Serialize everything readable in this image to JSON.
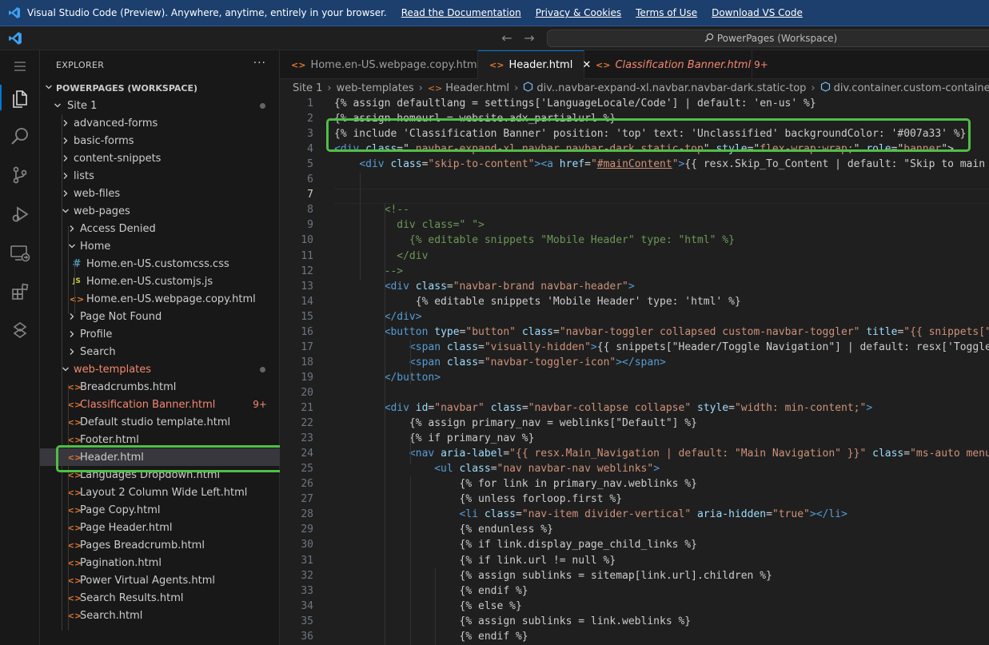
{
  "banner": {
    "text": "Visual Studio Code (Preview). Anywhere, anytime, entirely in your browser.",
    "links": [
      "Read the Documentation",
      "Privacy & Cookies",
      "Terms of Use",
      "Download VS Code"
    ]
  },
  "titlebar": {
    "command_center": "PowerPages (Workspace)"
  },
  "sidebar": {
    "title": "EXPLORER",
    "workspace": "POWERPAGES (WORKSPACE)",
    "tree": [
      {
        "label": "Site 1",
        "depth": 0,
        "kind": "folder-open",
        "modified": true
      },
      {
        "label": "advanced-forms",
        "depth": 1,
        "kind": "folder"
      },
      {
        "label": "basic-forms",
        "depth": 1,
        "kind": "folder"
      },
      {
        "label": "content-snippets",
        "depth": 1,
        "kind": "folder"
      },
      {
        "label": "lists",
        "depth": 1,
        "kind": "folder"
      },
      {
        "label": "web-files",
        "depth": 1,
        "kind": "folder"
      },
      {
        "label": "web-pages",
        "depth": 1,
        "kind": "folder-open"
      },
      {
        "label": "Access Denied",
        "depth": 2,
        "kind": "folder"
      },
      {
        "label": "Home",
        "depth": 2,
        "kind": "folder-open"
      },
      {
        "label": "Home.en-US.customcss.css",
        "depth": 3,
        "kind": "css"
      },
      {
        "label": "Home.en-US.customjs.js",
        "depth": 3,
        "kind": "js"
      },
      {
        "label": "Home.en-US.webpage.copy.html",
        "depth": 3,
        "kind": "html"
      },
      {
        "label": "Page Not Found",
        "depth": 2,
        "kind": "folder"
      },
      {
        "label": "Profile",
        "depth": 2,
        "kind": "folder"
      },
      {
        "label": "Search",
        "depth": 2,
        "kind": "folder"
      },
      {
        "label": "web-templates",
        "depth": 1,
        "kind": "folder-open",
        "error": true,
        "modified": true
      },
      {
        "label": "Breadcrumbs.html",
        "depth": 2,
        "kind": "html"
      },
      {
        "label": "Classification Banner.html",
        "depth": 2,
        "kind": "html",
        "error": true,
        "errors": "9+"
      },
      {
        "label": "Default studio template.html",
        "depth": 2,
        "kind": "html"
      },
      {
        "label": "Footer.html",
        "depth": 2,
        "kind": "html"
      },
      {
        "label": "Header.html",
        "depth": 2,
        "kind": "html",
        "selected": true
      },
      {
        "label": "Languages Dropdown.html",
        "depth": 2,
        "kind": "html"
      },
      {
        "label": "Layout 2 Column Wide Left.html",
        "depth": 2,
        "kind": "html"
      },
      {
        "label": "Page Copy.html",
        "depth": 2,
        "kind": "html"
      },
      {
        "label": "Page Header.html",
        "depth": 2,
        "kind": "html"
      },
      {
        "label": "Pages Breadcrumb.html",
        "depth": 2,
        "kind": "html"
      },
      {
        "label": "Pagination.html",
        "depth": 2,
        "kind": "html"
      },
      {
        "label": "Power Virtual Agents.html",
        "depth": 2,
        "kind": "html"
      },
      {
        "label": "Search Results.html",
        "depth": 2,
        "kind": "html"
      },
      {
        "label": "Search.html",
        "depth": 2,
        "kind": "html"
      }
    ]
  },
  "tabs": [
    {
      "label": "Home.en-US.webpage.copy.html"
    },
    {
      "label": "Header.html",
      "active": true
    },
    {
      "label": "Classification Banner.html",
      "error": true,
      "count": "9+"
    }
  ],
  "breadcrumbs": [
    "Site 1",
    "web-templates",
    "Header.html",
    "div..navbar-expand-xl.navbar.navbar-dark.static-top",
    "div.container.custom-container"
  ],
  "editor": {
    "current_line": 7,
    "lines": [
      [
        [
          "t",
          "{% assign defaultlang = settings['LanguageLocale/Code'] | default: 'en-us' %}"
        ]
      ],
      [
        [
          "t",
          "{% assign homeurl = website.adx_partialurl %}"
        ]
      ],
      [
        [
          "t",
          "{% include 'Classification Banner' position: 'top' text: 'Unclassified' backgroundColor: '#007a33' %}"
        ]
      ],
      [
        [
          "g",
          "<"
        ],
        [
          "g",
          "div "
        ],
        [
          "a",
          "class"
        ],
        [
          "t",
          "=\""
        ],
        [
          "s",
          " navbar-expand-xl navbar navbar-dark static-top"
        ],
        [
          "t",
          "\" "
        ],
        [
          "a",
          "style"
        ],
        [
          "t",
          "=\""
        ],
        [
          "s",
          "flex-wrap:wrap;"
        ],
        [
          "t",
          "\" "
        ],
        [
          "a",
          "role"
        ],
        [
          "t",
          "=\""
        ],
        [
          "s",
          "banner"
        ],
        [
          "t",
          "\">"
        ]
      ],
      [
        [
          "t",
          "    "
        ],
        [
          "g",
          "<div "
        ],
        [
          "a",
          "class"
        ],
        [
          "t",
          "="
        ],
        [
          "s",
          "\"skip-to-content\""
        ],
        [
          "g",
          ">"
        ],
        [
          "g",
          "<a "
        ],
        [
          "a",
          "href"
        ],
        [
          "t",
          "="
        ],
        [
          "s",
          "\""
        ],
        [
          "su",
          "#mainContent"
        ],
        [
          "s",
          "\""
        ],
        [
          "g",
          ">"
        ],
        [
          "t",
          "{{ resx.Skip_To_Content | default: \"Skip to main co"
        ]
      ],
      [
        [
          "t",
          ""
        ]
      ],
      [
        [
          "t",
          ""
        ]
      ],
      [
        [
          "t",
          "        "
        ],
        [
          "c",
          "<!--"
        ]
      ],
      [
        [
          "t",
          "          "
        ],
        [
          "c",
          "div class=\" \">"
        ]
      ],
      [
        [
          "t",
          "            "
        ],
        [
          "c",
          "{% editable snippets \"Mobile Header\" type: \"html\" %}"
        ]
      ],
      [
        [
          "t",
          "          "
        ],
        [
          "c",
          "</div"
        ]
      ],
      [
        [
          "t",
          "        "
        ],
        [
          "c",
          "-->"
        ]
      ],
      [
        [
          "t",
          "        "
        ],
        [
          "g",
          "<div "
        ],
        [
          "a",
          "class"
        ],
        [
          "t",
          "="
        ],
        [
          "s",
          "\"navbar-brand navbar-header\""
        ],
        [
          "g",
          ">"
        ]
      ],
      [
        [
          "t",
          "             {% editable snippets 'Mobile Header' type: 'html' %}"
        ]
      ],
      [
        [
          "t",
          "        "
        ],
        [
          "g",
          "</div>"
        ]
      ],
      [
        [
          "t",
          "        "
        ],
        [
          "g",
          "<button "
        ],
        [
          "a",
          "type"
        ],
        [
          "t",
          "="
        ],
        [
          "s",
          "\"button\""
        ],
        [
          "t",
          " "
        ],
        [
          "a",
          "class"
        ],
        [
          "t",
          "="
        ],
        [
          "s",
          "\"navbar-toggler collapsed custom-navbar-toggler\""
        ],
        [
          "t",
          " "
        ],
        [
          "a",
          "title"
        ],
        [
          "t",
          "="
        ],
        [
          "s",
          "\"{{ snippets[\"He"
        ]
      ],
      [
        [
          "t",
          "            "
        ],
        [
          "g",
          "<span "
        ],
        [
          "a",
          "class"
        ],
        [
          "t",
          "="
        ],
        [
          "s",
          "\"visually-hidden\""
        ],
        [
          "g",
          ">"
        ],
        [
          "t",
          "{{ snippets[\"Header/Toggle Navigation\"] | default: resx['Toggle_N"
        ]
      ],
      [
        [
          "t",
          "            "
        ],
        [
          "g",
          "<span "
        ],
        [
          "a",
          "class"
        ],
        [
          "t",
          "="
        ],
        [
          "s",
          "\"navbar-toggler-icon\""
        ],
        [
          "g",
          "></span>"
        ]
      ],
      [
        [
          "t",
          "        "
        ],
        [
          "g",
          "</button>"
        ]
      ],
      [
        [
          "t",
          ""
        ]
      ],
      [
        [
          "t",
          "        "
        ],
        [
          "g",
          "<div "
        ],
        [
          "a",
          "id"
        ],
        [
          "t",
          "="
        ],
        [
          "s",
          "\"navbar\""
        ],
        [
          "t",
          " "
        ],
        [
          "a",
          "class"
        ],
        [
          "t",
          "="
        ],
        [
          "s",
          "\"navbar-collapse collapse\""
        ],
        [
          "t",
          " "
        ],
        [
          "a",
          "style"
        ],
        [
          "t",
          "="
        ],
        [
          "s",
          "\"width: min-content;\""
        ],
        [
          "g",
          ">"
        ]
      ],
      [
        [
          "t",
          "            {% assign primary_nav = weblinks[\"Default\"] %}"
        ]
      ],
      [
        [
          "t",
          "            {% if primary_nav %}"
        ]
      ],
      [
        [
          "t",
          "            "
        ],
        [
          "g",
          "<nav "
        ],
        [
          "a",
          "aria-label"
        ],
        [
          "t",
          "="
        ],
        [
          "s",
          "\"{{ resx.Main_Navigation | default: \"Main Navigation\" }}\""
        ],
        [
          "t",
          " "
        ],
        [
          "a",
          "class"
        ],
        [
          "t",
          "="
        ],
        [
          "s",
          "\"ms-auto menu-b"
        ]
      ],
      [
        [
          "t",
          "                "
        ],
        [
          "g",
          "<ul "
        ],
        [
          "a",
          "class"
        ],
        [
          "t",
          "="
        ],
        [
          "s",
          "\"nav navbar-nav weblinks\""
        ],
        [
          "g",
          ">"
        ]
      ],
      [
        [
          "t",
          "                    {% for link in primary_nav.weblinks %}"
        ]
      ],
      [
        [
          "t",
          "                    {% unless forloop.first %}"
        ]
      ],
      [
        [
          "t",
          "                    "
        ],
        [
          "g",
          "<li "
        ],
        [
          "a",
          "class"
        ],
        [
          "t",
          "="
        ],
        [
          "s",
          "\"nav-item divider-vertical\""
        ],
        [
          "t",
          " "
        ],
        [
          "a",
          "aria-hidden"
        ],
        [
          "t",
          "="
        ],
        [
          "s",
          "\"true\""
        ],
        [
          "g",
          "></li>"
        ]
      ],
      [
        [
          "t",
          "                    {% endunless %}"
        ]
      ],
      [
        [
          "t",
          "                    {% if link.display_page_child_links %}"
        ]
      ],
      [
        [
          "t",
          "                    {% if link.url != null %}"
        ]
      ],
      [
        [
          "t",
          "                    {% assign sublinks = sitemap[link.url].children %}"
        ]
      ],
      [
        [
          "t",
          "                    {% endif %}"
        ]
      ],
      [
        [
          "t",
          "                    {% else %}"
        ]
      ],
      [
        [
          "t",
          "                    {% assign sublinks = link.weblinks %}"
        ]
      ],
      [
        [
          "t",
          "                    {% endif %}"
        ]
      ]
    ]
  },
  "colors": {
    "accent": "#0078d4",
    "highlight_box": "#4fbf45",
    "error": "#f48771",
    "banner_bg": "#1c3f6e"
  }
}
